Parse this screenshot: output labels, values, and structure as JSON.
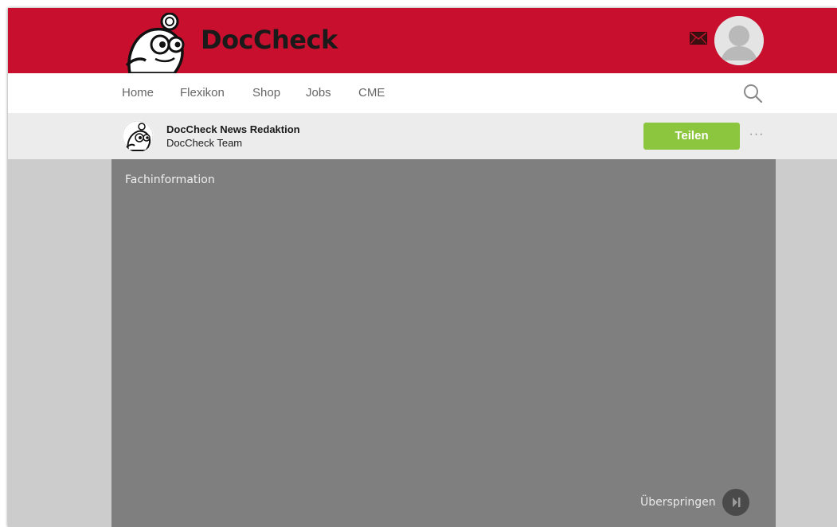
{
  "header": {
    "logo_text": "DocCheck",
    "brand_color": "#c8102e",
    "mail_icon": "mail-icon",
    "avatar_icon": "user-avatar-icon"
  },
  "nav": {
    "items": [
      {
        "label": "Home"
      },
      {
        "label": "Flexikon"
      },
      {
        "label": "Shop"
      },
      {
        "label": "Jobs"
      },
      {
        "label": "CME"
      }
    ],
    "search_icon": "search-icon"
  },
  "author": {
    "name": "DocCheck News Redaktion",
    "team": "DocCheck Team",
    "share_label": "Teilen",
    "share_color": "#8cc63f",
    "more_label": "···"
  },
  "ad": {
    "label": "Fachinformation",
    "skip_label": "Überspringen",
    "skip_icon": "skip-forward-icon"
  }
}
